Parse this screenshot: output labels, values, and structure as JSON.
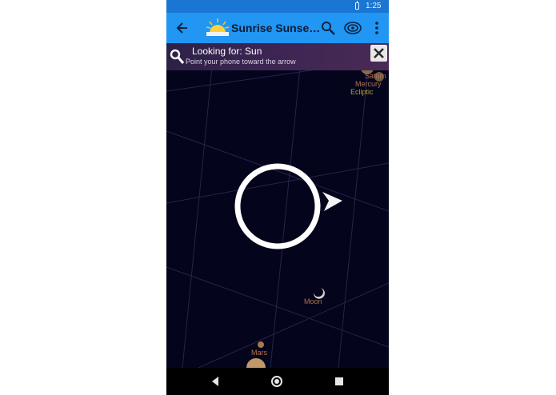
{
  "status_bar": {
    "time": "1:25"
  },
  "app_bar": {
    "title": "Sunrise Sunset Lite"
  },
  "search_banner": {
    "heading": "Looking for: Sun",
    "instruction": "Point your phone toward the arrow"
  },
  "sky_labels": {
    "saturn": "Saturn",
    "mercury": "Mercury",
    "ecliptic": "Ecliptic",
    "moon": "Moon",
    "mars": "Mars"
  },
  "colors": {
    "status_bar": "#1976d2",
    "app_bar": "#2196f3",
    "sky": "#04041c",
    "planet_label": "#b5754a",
    "ecliptic_label": "#b2a23a"
  },
  "icons": {
    "back": "arrow-back-icon",
    "logo": "sunrise-logo-icon",
    "search": "search-icon",
    "target": "target-icon",
    "more": "more-vert-icon",
    "close": "close-icon",
    "pointer": "direction-arrow-icon"
  }
}
